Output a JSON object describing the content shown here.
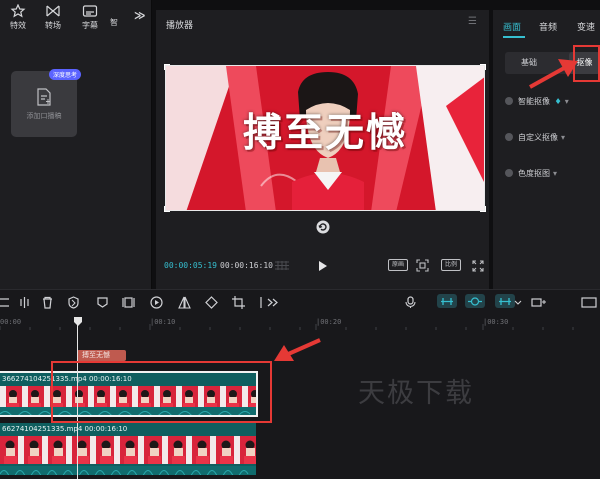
{
  "left_panel": {
    "tabs": [
      {
        "label": "特效",
        "icon": "effects-icon"
      },
      {
        "label": "转场",
        "icon": "transition-icon"
      },
      {
        "label": "字幕",
        "icon": "subtitle-icon"
      },
      {
        "label": "智",
        "icon": ""
      }
    ],
    "more_label": "≫",
    "media_card": {
      "badge": "深度思考",
      "label": "添加口播稿"
    }
  },
  "player": {
    "title": "播放器",
    "subtitle_text": "搏至无憾",
    "current_time": "00:00:05:19",
    "total_time": "00:00:16:10",
    "ratio_label": "原画",
    "aspect_label": "比例"
  },
  "right_panel": {
    "tabs": [
      "画面",
      "音频",
      "变速"
    ],
    "sub_tabs": {
      "basic": "基础",
      "cutout": "抠像"
    },
    "options": [
      "智能抠像",
      "自定义抠像",
      "色度抠图"
    ]
  },
  "timeline": {
    "ruler_labels": [
      "00:00",
      "|00:10",
      "|00:20",
      "|00:30"
    ],
    "text_clip": "搏至无憾",
    "track1_label": "366274104251335.mp4  00:00:16:10",
    "track2_label": "66274104251335.mp4  00:00:16:10",
    "watermark": "天极下载"
  },
  "colors": {
    "accent": "#36bfd0",
    "highlight": "#e53935",
    "clip_teal": "#0f5e5f",
    "text_clip": "#bf5a4f"
  }
}
